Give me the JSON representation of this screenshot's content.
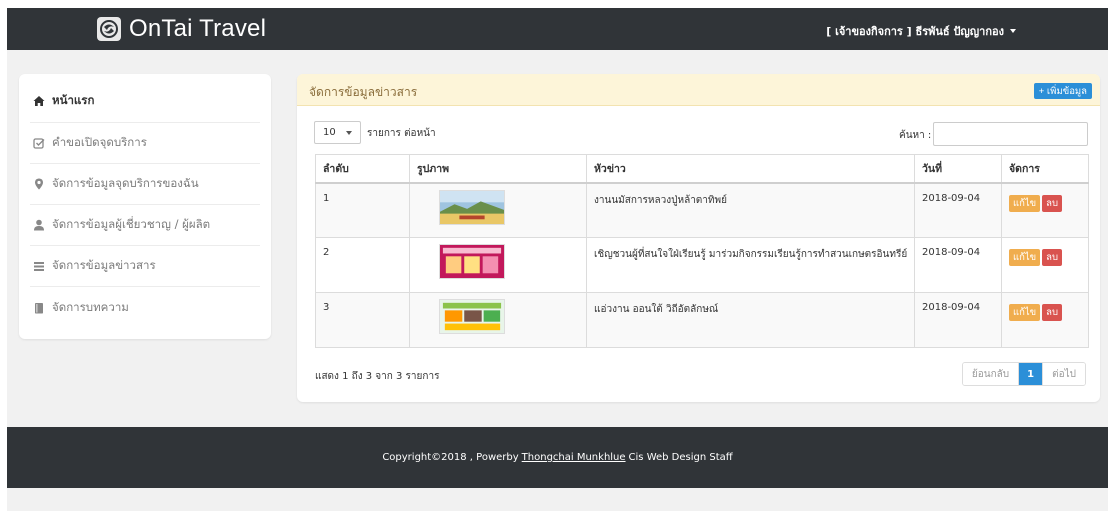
{
  "navbar": {
    "brand": "OnTai Travel",
    "user_label": "[ เจ้าของกิจการ ] ธีรพันธ์ ปัญญากอง"
  },
  "sidebar": {
    "items": [
      {
        "label": "หน้าแรก",
        "icon": "home-icon",
        "active": true
      },
      {
        "label": "คำขอเปิดจุดบริการ",
        "icon": "checkbox-icon",
        "active": false
      },
      {
        "label": "จัดการข้อมูลจุดบริการของฉัน",
        "icon": "map-marker-icon",
        "active": false
      },
      {
        "label": "จัดการข้อมูลผู้เชี่ยวชาญ / ผู้ผลิต",
        "icon": "user-icon",
        "active": false
      },
      {
        "label": "จัดการข้อมูลข่าวสาร",
        "icon": "list-icon",
        "active": false
      },
      {
        "label": "จัดการบทความ",
        "icon": "book-icon",
        "active": false
      }
    ]
  },
  "panel": {
    "title": "จัดการข้อมูลข่าวสาร",
    "add_label": "+ เพิ่มข้อมูล",
    "length_value": "10",
    "length_label": "รายการ ต่อหน้า",
    "search_label": "ค้นหา :",
    "search_value": "",
    "columns": [
      "ลำดับ",
      "รูปภาพ",
      "หัวข่าว",
      "วันที่",
      "จัดการ"
    ],
    "rows": [
      {
        "no": "1",
        "title": "งานนมัสการหลวงปู่หล้าตาทิพย์",
        "date": "2018-09-04",
        "edit": "แก้ไข",
        "delete": "ลบ"
      },
      {
        "no": "2",
        "title": "เชิญชวนผู้ที่สนใจใฝ่เรียนรู้ มาร่วมกิจกรรมเรียนรู้การทำสวนเกษตรอินทรีย์",
        "date": "2018-09-04",
        "edit": "แก้ไข",
        "delete": "ลบ"
      },
      {
        "no": "3",
        "title": "แอ่วงาน ออนใต้ วิถีอัตลักษณ์",
        "date": "2018-09-04",
        "edit": "แก้ไข",
        "delete": "ลบ"
      }
    ],
    "info": "แสดง 1 ถึง 3 จาก 3 รายการ",
    "pager": {
      "prev": "ย้อนกลับ",
      "current": "1",
      "next": "ต่อไป"
    }
  },
  "footer": {
    "prefix": "Copyright©2018 , Powerby",
    "author": "Thongchai Munkhlue",
    "suffix": "Cis Web Design Staff"
  },
  "colors": {
    "navbar": "#303438",
    "primary": "#2b8fd8",
    "edit": "#f0ad4e",
    "delete": "#d9534f",
    "panel_head": "#fdf5d9"
  }
}
